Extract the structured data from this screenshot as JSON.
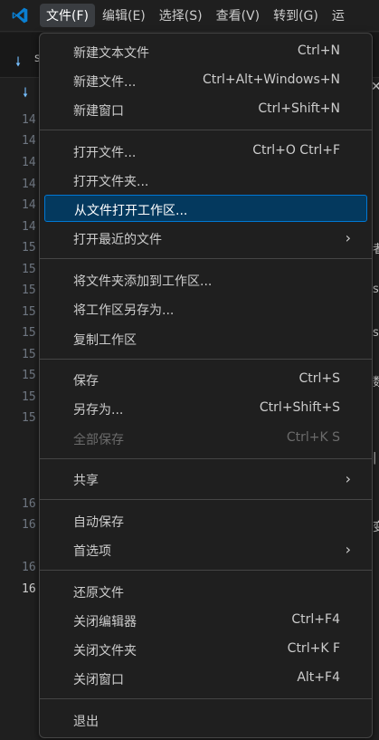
{
  "menubar": {
    "items": [
      {
        "label": "文件(F)"
      },
      {
        "label": "编辑(E)"
      },
      {
        "label": "选择(S)"
      },
      {
        "label": "查看(V)"
      },
      {
        "label": "转到(G)"
      },
      {
        "label": "运"
      }
    ]
  },
  "editor": {
    "tab_fragment": "s",
    "line_numbers": [
      "14",
      "14",
      "14",
      "14",
      "14",
      "14",
      "15",
      "15",
      "15",
      "15",
      "15",
      "15",
      "15",
      "15",
      "15",
      "16",
      "16",
      "16",
      "16"
    ],
    "right_fragments": [
      "者",
      "s",
      "s",
      "数",
      "|",
      "变"
    ]
  },
  "menu": {
    "items": [
      {
        "label": "新建文本文件",
        "shortcut": "Ctrl+N"
      },
      {
        "label": "新建文件...",
        "shortcut": "Ctrl+Alt+Windows+N"
      },
      {
        "label": "新建窗口",
        "shortcut": "Ctrl+Shift+N"
      },
      {
        "label": "打开文件...",
        "shortcut": "Ctrl+O Ctrl+F"
      },
      {
        "label": "打开文件夹...",
        "shortcut": ""
      },
      {
        "label": "从文件打开工作区...",
        "shortcut": ""
      },
      {
        "label": "打开最近的文件",
        "shortcut": ""
      },
      {
        "label": "将文件夹添加到工作区...",
        "shortcut": ""
      },
      {
        "label": "将工作区另存为...",
        "shortcut": ""
      },
      {
        "label": "复制工作区",
        "shortcut": ""
      },
      {
        "label": "保存",
        "shortcut": "Ctrl+S"
      },
      {
        "label": "另存为...",
        "shortcut": "Ctrl+Shift+S"
      },
      {
        "label": "全部保存",
        "shortcut": "Ctrl+K S"
      },
      {
        "label": "共享",
        "shortcut": ""
      },
      {
        "label": "自动保存",
        "shortcut": ""
      },
      {
        "label": "首选项",
        "shortcut": ""
      },
      {
        "label": "还原文件",
        "shortcut": ""
      },
      {
        "label": "关闭编辑器",
        "shortcut": "Ctrl+F4"
      },
      {
        "label": "关闭文件夹",
        "shortcut": "Ctrl+K F"
      },
      {
        "label": "关闭窗口",
        "shortcut": "Alt+F4"
      },
      {
        "label": "退出",
        "shortcut": ""
      }
    ]
  },
  "colors": {
    "highlight_bg": "#04395e",
    "highlight_border": "#0078d4",
    "logo": "#0a7fd2",
    "menu_bg": "#1f1f1f"
  }
}
